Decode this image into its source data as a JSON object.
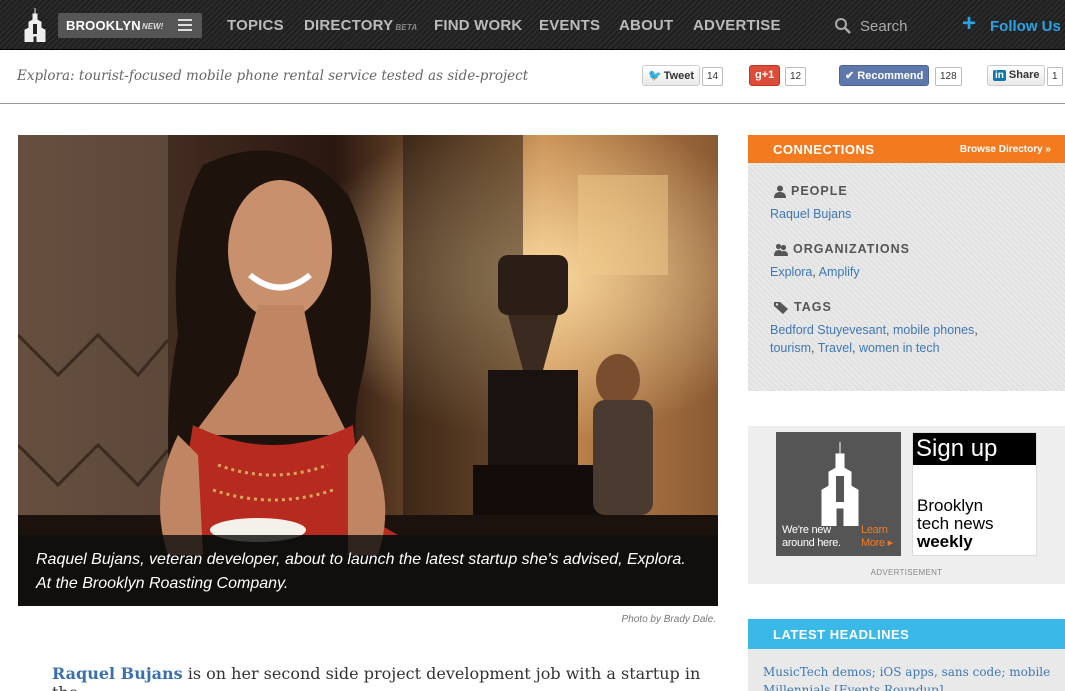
{
  "nav": {
    "city": "BROOKLYN",
    "city_tag": "NEW!",
    "links": [
      "TOPICS",
      "DIRECTORY",
      "FIND WORK",
      "EVENTS",
      "ABOUT",
      "ADVERTISE"
    ],
    "directory_tag": "BETA",
    "search_label": "Search",
    "follow_label": "Follow Us"
  },
  "subhead": {
    "headline": "Explora: tourist-focused mobile phone rental service tested as side-project",
    "share": {
      "tweet_label": "Tweet",
      "tweet_count": "14",
      "gplus_label": "+1",
      "gplus_count": "12",
      "fb_label": "Recommend",
      "fb_count": "128",
      "li_label": "Share",
      "li_count": "1"
    }
  },
  "hero": {
    "caption": "Raquel Bujans, veteran developer, about to launch the latest startup she's advised, Explora. At the Brooklyn Roasting Company.",
    "credit": "Photo by Brady Dale."
  },
  "article": {
    "lead_link": "Raquel Bujans",
    "lead_text": " is on her second side project development job with a startup in the"
  },
  "connections": {
    "title": "CONNECTIONS",
    "browse": "Browse Directory »",
    "people_label": "PEOPLE",
    "people": [
      "Raquel Bujans"
    ],
    "orgs_label": "ORGANIZATIONS",
    "orgs": [
      "Explora",
      "Amplify"
    ],
    "tags_label": "TAGS",
    "tags": [
      "Bedford Stuyevesant",
      "mobile phones",
      "tourism",
      "Travel",
      "women in tech"
    ]
  },
  "ad": {
    "left_line1": "We're new",
    "left_line2": "around here.",
    "learn_line1": "Learn",
    "learn_line2": "More ▸",
    "signup": "Sign up",
    "news_line1": "Brooklyn",
    "news_line2": "tech news",
    "news_line3": "weekly",
    "label": "ADVERTISEMENT"
  },
  "latest": {
    "title": "LATEST HEADLINES",
    "item": "MusicTech demos; iOS apps, sans code; mobile Millennials [Events Roundup]"
  },
  "colors": {
    "orange": "#f47a20",
    "blue": "#3ab8e8",
    "link": "#3f78b3",
    "nav_bg": "#222222"
  }
}
